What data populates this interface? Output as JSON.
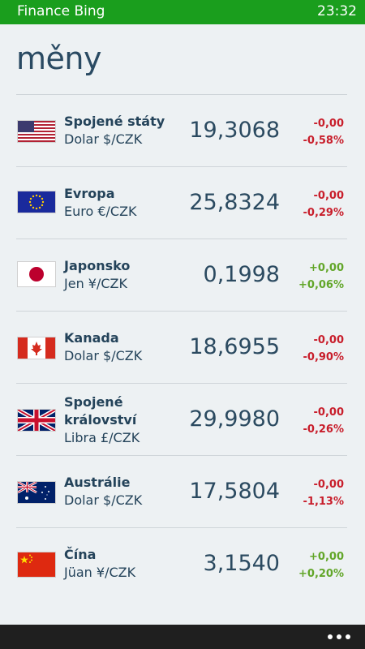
{
  "status_bar": {
    "app_title": "Finance Bing",
    "time": "23:32"
  },
  "page": {
    "title": "měny"
  },
  "currencies": [
    {
      "country": "Spojené státy",
      "pair": "Dolar $/CZK",
      "rate": "19,3068",
      "change": "-0,00",
      "change_pct": "-0,58%",
      "direction": "down",
      "flag": "us-flag-icon"
    },
    {
      "country": "Evropa",
      "pair": "Euro €/CZK",
      "rate": "25,8324",
      "change": "-0,00",
      "change_pct": "-0,29%",
      "direction": "down",
      "flag": "eu-flag-icon"
    },
    {
      "country": "Japonsko",
      "pair": "Jen ¥/CZK",
      "rate": "0,1998",
      "change": "+0,00",
      "change_pct": "+0,06%",
      "direction": "up",
      "flag": "japan-flag-icon"
    },
    {
      "country": "Kanada",
      "pair": "Dolar $/CZK",
      "rate": "18,6955",
      "change": "-0,00",
      "change_pct": "-0,90%",
      "direction": "down",
      "flag": "canada-flag-icon"
    },
    {
      "country": "Spojené království",
      "pair": "Libra £/CZK",
      "rate": "29,9980",
      "change": "-0,00",
      "change_pct": "-0,26%",
      "direction": "down",
      "flag": "uk-flag-icon"
    },
    {
      "country": "Austrálie",
      "pair": "Dolar $/CZK",
      "rate": "17,5804",
      "change": "-0,00",
      "change_pct": "-1,13%",
      "direction": "down",
      "flag": "australia-flag-icon"
    },
    {
      "country": "Čína",
      "pair": "Jüan ¥/CZK",
      "rate": "3,1540",
      "change": "+0,00",
      "change_pct": "+0,20%",
      "direction": "up",
      "flag": "china-flag-icon"
    }
  ],
  "app_bar": {
    "more_icon": "more-dots-icon"
  },
  "colors": {
    "status_green": "#1a9e1d",
    "negative": "#c81e2b",
    "positive": "#62a629",
    "text": "#24435a"
  }
}
